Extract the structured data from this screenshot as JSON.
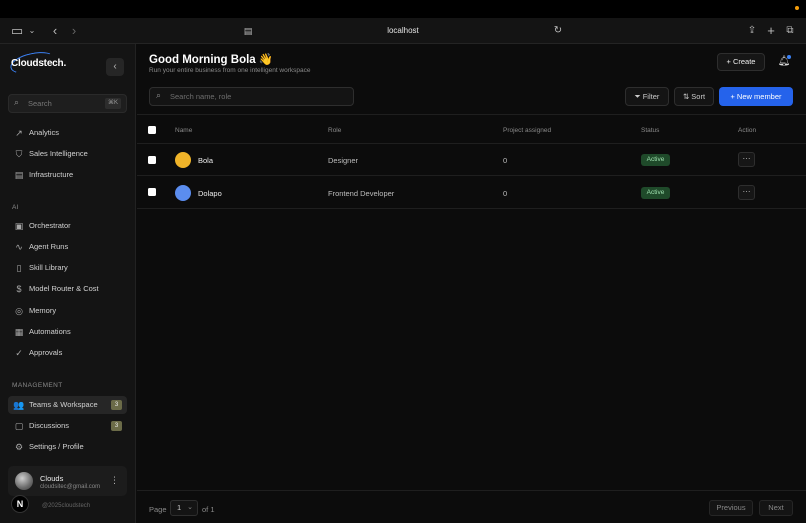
{
  "browser": {
    "url": "localhost",
    "icons": [
      "sidebar-icon",
      "chevron-down-icon",
      "back-icon",
      "forward-icon",
      "page-icon",
      "reload-icon",
      "share-icon",
      "new-tab-icon",
      "tabs-icon"
    ]
  },
  "sidebar": {
    "logo": "Cloudstech.",
    "search_placeholder": "Search",
    "search_shortcut": "⌘K",
    "items": [
      {
        "label": "Analytics",
        "icon": "trend-icon"
      },
      {
        "label": "Sales Intelligence",
        "icon": "shield-icon"
      },
      {
        "label": "Infrastructure",
        "icon": "server-icon"
      }
    ],
    "ai_label": "AI",
    "ai_items": [
      {
        "label": "Orchestrator",
        "icon": "briefcase-icon"
      },
      {
        "label": "Agent Runs",
        "icon": "activity-icon"
      },
      {
        "label": "Skill Library",
        "icon": "book-icon"
      },
      {
        "label": "Model Router & Cost",
        "icon": "dollar-icon"
      },
      {
        "label": "Memory",
        "icon": "database-icon"
      },
      {
        "label": "Automations",
        "icon": "calendar-icon"
      },
      {
        "label": "Approvals",
        "icon": "check-shield-icon"
      }
    ],
    "management_label": "MANAGEMENT",
    "management_items": [
      {
        "label": "Teams & Workspace",
        "icon": "users-icon",
        "count": "3",
        "active": true
      },
      {
        "label": "Discussions",
        "icon": "chat-icon",
        "count": "3"
      },
      {
        "label": "Settings / Profile",
        "icon": "gear-icon"
      }
    ],
    "user": {
      "name": "Clouds",
      "email": "cloudsitec@gmail.com"
    },
    "badge": "N",
    "copyright": "@2025cloudstech"
  },
  "header": {
    "greeting": "Good Morning Bola 👋",
    "subtitle": "Run your entire business from one intelligent workspace",
    "create_label": "+ Create"
  },
  "toolbar": {
    "search_placeholder": "Search name, role",
    "filter_label": "Filter",
    "sort_label": "Sort",
    "new_member_label": "+ New member"
  },
  "table": {
    "columns": [
      "Name",
      "Role",
      "Project assigned",
      "Status",
      "Action"
    ],
    "rows": [
      {
        "name": "Bola",
        "role": "Designer",
        "projects": "0",
        "status": "Active",
        "avatar_color": "#f0b429"
      },
      {
        "name": "Dolapo",
        "role": "Frontend Developer",
        "projects": "0",
        "status": "Active",
        "avatar_color": "#5b8def"
      }
    ],
    "action_label": "···"
  },
  "pagination": {
    "page_label": "Page",
    "current_page": "1",
    "of_label": "of 1",
    "previous": "Previous",
    "next": "Next"
  },
  "colors": {
    "accent": "#2563eb",
    "status_bg": "#1f4a2a",
    "status_text": "#9ee0ae"
  }
}
